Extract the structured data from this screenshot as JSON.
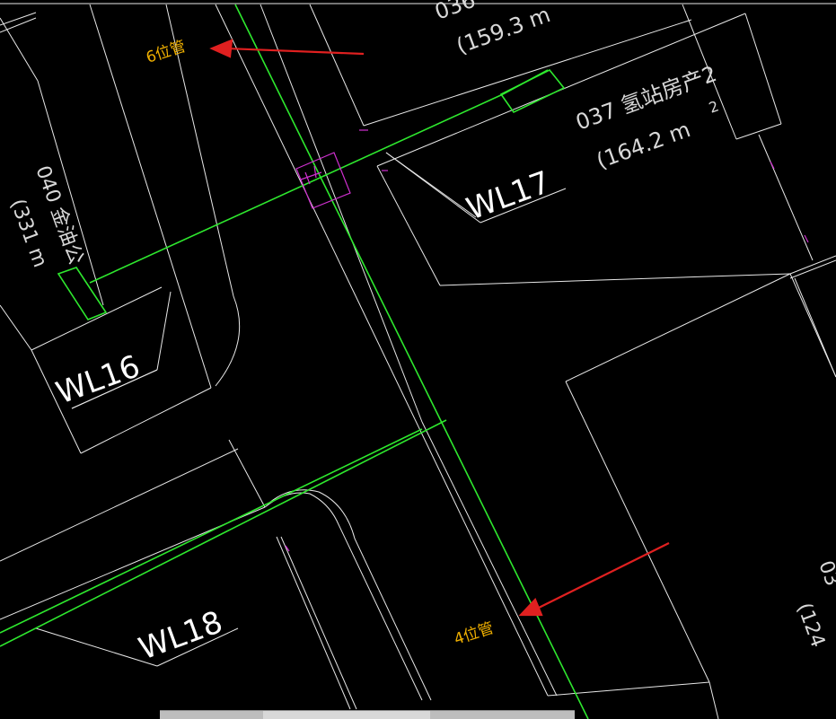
{
  "labels": {
    "pipe_6": "6位管",
    "pipe_4": "4位管",
    "wl16": "WL16",
    "wl17": "WL17",
    "wl18": "WL18",
    "lot_037_name": "037 氢站房产2",
    "lot_037_area": "(164.2 m",
    "lot_037_sup": "2",
    "lot_036_name": "036",
    "lot_036_area": "(159.3 m",
    "lot_040_name": "040 金油公",
    "lot_040_area": "(331 m",
    "lot_right_name": "03",
    "lot_right_area": "(124"
  },
  "colors": {
    "background": "#000000",
    "building_line": "#e8e8e8",
    "pipe_line": "#2ee82e",
    "fixture": "#d030d0",
    "annotation": "#f0b000",
    "arrow": "#e02020"
  }
}
